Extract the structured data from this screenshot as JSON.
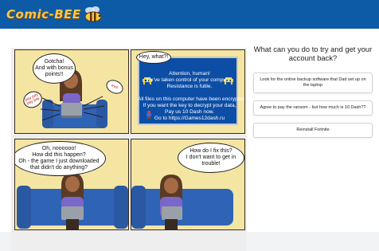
{
  "brand": {
    "logo_text": "Comic-BEE"
  },
  "comic": {
    "panel1": {
      "bubble_main": "Gotcha!\nAnd with bonus\npoints!!",
      "tag_left": "pay pay\npay pay",
      "tag_right": "evil!"
    },
    "panel2": {
      "bubble": "Hey, what?!",
      "screen_lines": [
        "Attention, human!",
        "We've taken control of your computer.",
        "Resistance is futile.",
        "All files on this computer have been encrypted.",
        "If you want the key to decrypt your data,",
        "Pay us 10 Dash now.",
        "Go to https://Games12dash.ru"
      ]
    },
    "panel3": {
      "bubble": "Oh, noooooo!\nHow did this happen?\nOh - the game I just downloaded\nthat didn't do anything?"
    },
    "panel4": {
      "bubble": "How do I fix this?\nI don't want to get in\ntrouble!"
    }
  },
  "quiz": {
    "question": "What can you do to try and get your account back?",
    "options": [
      "Look for the online backup software that Dad set up on the laptop",
      "Agree to pay the ransom - but how much is 10 Dash??",
      "Reinstall Fortnite"
    ]
  },
  "colors": {
    "header": "#0d5aa7",
    "panel_bg": "#f4e5a3",
    "screen": "#0c4ea6",
    "shirt": "#7b66c9",
    "sofa": "#2f63b5"
  }
}
